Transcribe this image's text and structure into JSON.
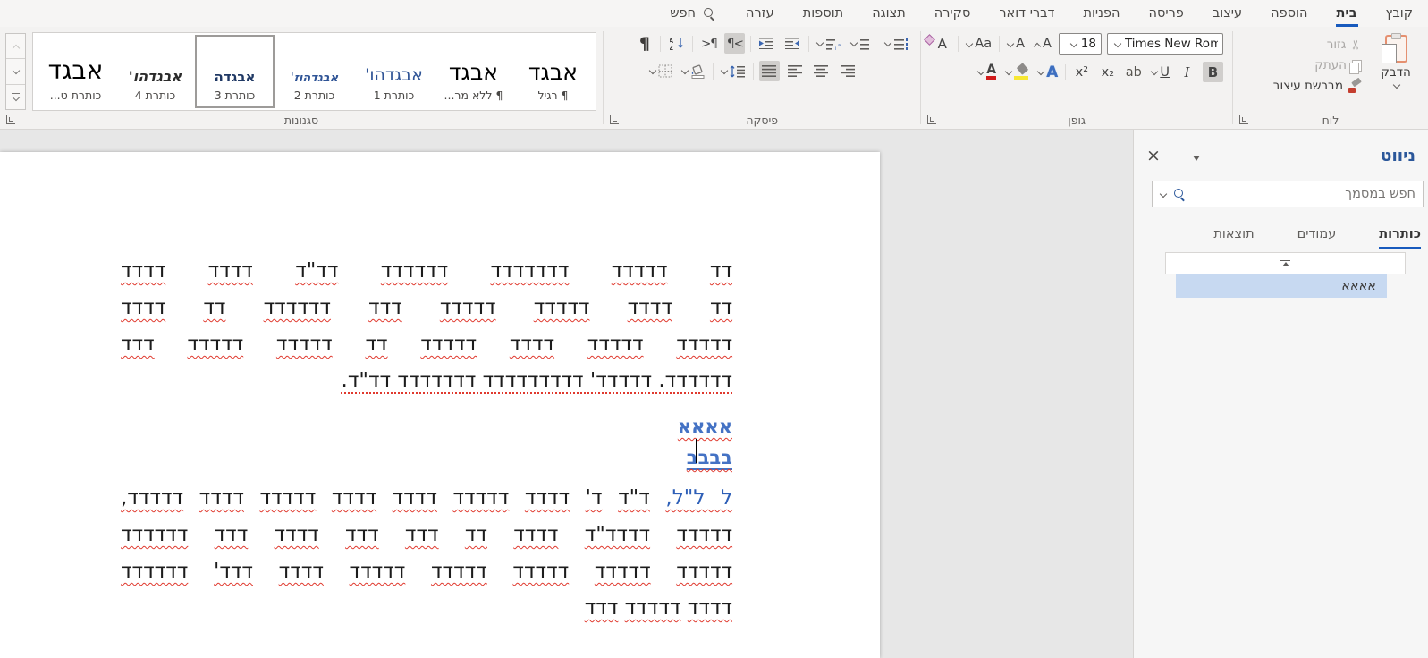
{
  "menubar": {
    "tabs": [
      {
        "label": "קובץ",
        "active": false
      },
      {
        "label": "בית",
        "active": true
      },
      {
        "label": "הוספה",
        "active": false
      },
      {
        "label": "עיצוב",
        "active": false
      },
      {
        "label": "פריסה",
        "active": false
      },
      {
        "label": "הפניות",
        "active": false
      },
      {
        "label": "דברי דואר",
        "active": false
      },
      {
        "label": "סקירה",
        "active": false
      },
      {
        "label": "תצוגה",
        "active": false
      },
      {
        "label": "תוספות",
        "active": false
      },
      {
        "label": "עזרה",
        "active": false
      }
    ],
    "search_label": "חפש"
  },
  "ribbon": {
    "clipboard": {
      "group_label": "לוח",
      "paste_label": "הדבק",
      "cut_label": "גזור",
      "copy_label": "העתק",
      "format_painter_label": "מברשת עיצוב",
      "cut_enabled": false,
      "copy_enabled": false
    },
    "font": {
      "group_label": "גופן",
      "font_name": "Times New Roman",
      "font_size": "18",
      "glyphs": {
        "bold": "B",
        "italic": "I",
        "underline": "U",
        "strikethrough": "ab",
        "subscript": "x₂",
        "superscript": "x²",
        "change_case": "Aa",
        "clear_format": "A",
        "grow_font": "A",
        "shrink_font": "A",
        "text_effects": "A",
        "font_color": "A",
        "scissors": "✂"
      },
      "bold_active": true
    },
    "paragraph": {
      "group_label": "פיסקה",
      "glyphs": {
        "pilcrow": "¶",
        "ltr_direction": ">¶",
        "rtl_direction": "¶<",
        "sort_a": "A",
        "sort_z": "Z",
        "sort_arrow": "↓"
      },
      "rtl_direction_active": true,
      "justify_active": true
    },
    "styles": {
      "group_label": "סגנונות",
      "items": [
        {
          "preview": "אבגד",
          "label": "¶ רגיל",
          "kind": "normal",
          "selected": false
        },
        {
          "preview": "אבגד",
          "label": "¶ ללא מר...",
          "kind": "nospace",
          "selected": false
        },
        {
          "preview": "אבגדהו'",
          "label": "כותרת 1",
          "kind": "h1",
          "selected": false
        },
        {
          "preview": "אבגדהוז'",
          "label": "כותרת 2",
          "kind": "h2",
          "selected": false
        },
        {
          "preview": "אבגדה",
          "label": "כותרת 3",
          "kind": "h3",
          "selected": true
        },
        {
          "preview": "אבגדהו'",
          "label": "כותרת 4",
          "kind": "h4",
          "selected": false
        },
        {
          "preview": "אבגד",
          "label": "כותרת ט...",
          "kind": "h9",
          "selected": false
        }
      ]
    }
  },
  "navigation": {
    "title": "ניווט",
    "search_placeholder": "חפש במסמך",
    "tabs": [
      {
        "label": "כותרות",
        "active": true
      },
      {
        "label": "עמודים",
        "active": false
      },
      {
        "label": "תוצאות",
        "active": false
      }
    ],
    "items": [
      {
        "label": "אאאא",
        "highlighted": true
      }
    ]
  },
  "document": {
    "paragraph1": {
      "lines": [
        "דד דדדדד דדדדדדד דדדדדד דד\"ד דדדד דדדד",
        "דד דדדד דדדדד דדדדד דדד דדדדדד דד דדדד",
        "דדדדד דדדדד דדדד דדדדד דד דדדדד דדדדד דדד",
        "דדדדדד. דדדדד' דדדדדדדדד דדדדדדד דד\"ד."
      ],
      "last_line_spell": "dotted"
    },
    "heading1": "אאאא",
    "heading2": "בבבב",
    "paragraph2": {
      "lead": "ל ל\"ל,",
      "lines": [
        "ד\"ד ד' דדדד דדדדד דדדד דדדד דדדדד דדדד דדדדד,",
        "דדדדד דדדד\"ד דדדד דד דדד דדד דדדד דדד דדדדדד",
        "דדדדד דדדדד דדדדד דדדדד דדדדד דדדד דדד' דדדדדד",
        "דדדד דדדדד דדד"
      ],
      "last_line_spell": "wavy"
    }
  },
  "colors": {
    "accent_blue": "#185abd",
    "heading_blue": "#4472c4",
    "squiggle_red": "#e0392e",
    "selection_blue": "#c7d9f1",
    "ribbon_bg": "#f3f2f1"
  }
}
